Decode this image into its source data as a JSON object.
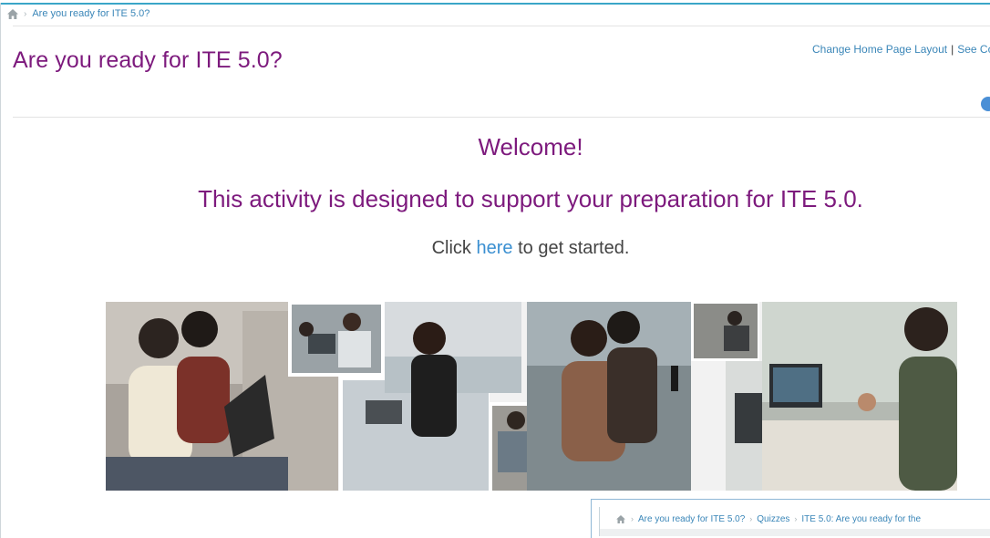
{
  "breadcrumb": {
    "home_icon": "home-icon",
    "items": [
      "Are you ready for ITE 5.0?"
    ]
  },
  "page": {
    "title": "Are you ready for ITE 5.0?"
  },
  "top_links": {
    "change_layout": "Change Home Page Layout",
    "separator": "|",
    "see_more": "See Co"
  },
  "welcome": {
    "heading": "Welcome!",
    "subheading": "This activity is designed to support your preparation for ITE 5.0.",
    "cta_prefix": "Click",
    "cta_link": "here",
    "cta_suffix": "to get started."
  },
  "overlay_window": {
    "breadcrumb": [
      "Are you ready for ITE 5.0?",
      "Quizzes",
      "ITE 5.0: Are you ready for the"
    ]
  },
  "colors": {
    "title_purple": "#7d1a7d",
    "link_blue": "#3a86b8",
    "accent_line": "#3aa6c8"
  }
}
